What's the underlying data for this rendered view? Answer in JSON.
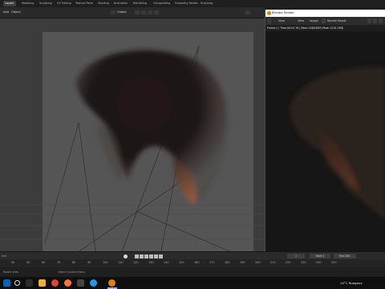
{
  "topbar": {
    "tabs": [
      "Layout",
      "Modeling",
      "Sculpting",
      "UV Editing",
      "Texture Paint",
      "Shading",
      "Animation",
      "Rendering",
      "Compositing",
      "Geometry Nodes",
      "Scripting"
    ],
    "active_tab": "Layout"
  },
  "viewport_header": {
    "add_label": "Add",
    "object_label": "Object",
    "transform_orientation": "Global"
  },
  "render_window": {
    "title": "Blender Render",
    "menu": {
      "view": "View",
      "view2": "View",
      "image": "Image",
      "slot": "Render Result"
    },
    "status": "Frame:1 | Time:00:03.76 | Mem:1348.65M (Peak 1210.13M)"
  },
  "timeline": {
    "frame_label": "rter",
    "current_frame": "1",
    "start_label": "Start",
    "start_value": "1",
    "end_label": "End",
    "end_value": "250",
    "ticks": [
      "40",
      "50",
      "60",
      "70",
      "80",
      "90",
      "100",
      "110",
      "120",
      "130",
      "140",
      "150",
      "160",
      "170",
      "180",
      "190",
      "200",
      "210",
      "220",
      "230",
      "240",
      "250"
    ]
  },
  "status_strip": {
    "left": "Rotate View",
    "center": "Object Context Menu"
  },
  "taskbar": {
    "weather": "14°C  Nuageux",
    "colors": {
      "start": "#0a64ad",
      "search": "#ffffff",
      "folder": "#e8b03c",
      "chrome": "#db4437",
      "firefox": "#ff7139",
      "edge": "#1e9be0",
      "blender": "#e87d0d"
    }
  }
}
